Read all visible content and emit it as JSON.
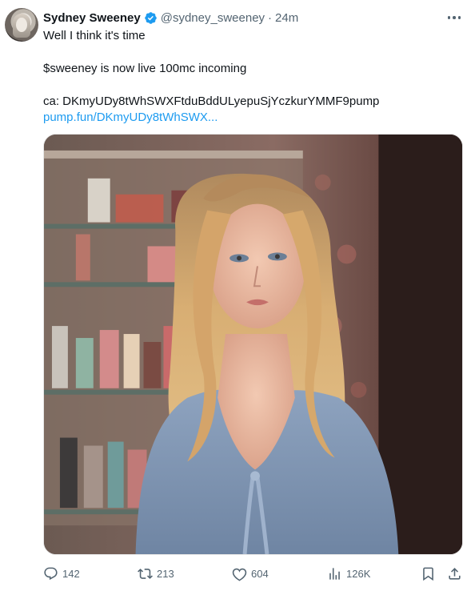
{
  "author": {
    "name": "Sydney Sweeney",
    "handle": "@sydney_sweeney",
    "separator": "·",
    "time": "24m",
    "verified": true
  },
  "tweet": {
    "line1": "Well I think it's time",
    "line2": "$sweeney is now live 100mc incoming",
    "line3": "ca: DKmyUDy8tWhSWXFtduBddULyepuSjYczkurYMMF9pump",
    "link_text": "pump.fun/DKmyUDy8tWhSWX..."
  },
  "media": {
    "icon": "photo"
  },
  "actions": {
    "replies": "142",
    "reposts": "213",
    "likes": "604",
    "views": "126K"
  },
  "colors": {
    "text": "#0f1419",
    "secondary": "#536471",
    "link": "#1d9bf0",
    "verified": "#1d9bf0"
  },
  "icons": [
    "more-dots-icon",
    "verified-badge-icon",
    "reply-icon",
    "repost-icon",
    "like-icon",
    "views-icon",
    "bookmark-icon",
    "share-icon"
  ]
}
